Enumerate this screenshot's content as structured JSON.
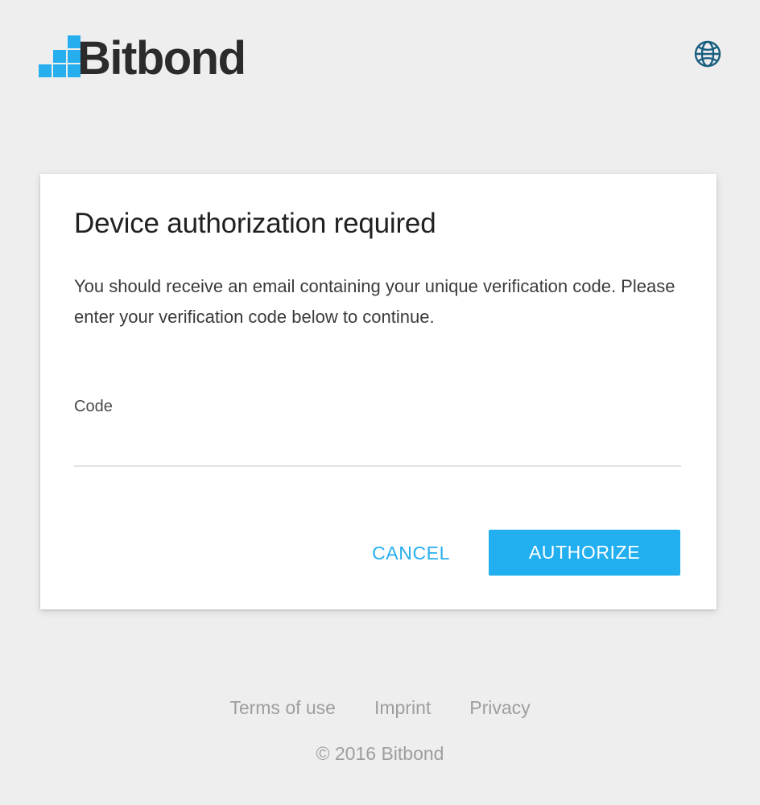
{
  "page": {
    "background_color": "#eeeeee",
    "accent_color": "#21aff0",
    "globe_color": "#1a5f80"
  },
  "header": {
    "logo_text": "Bitbond",
    "logo_icon": "bitbond-staircase-squares-icon",
    "language_icon": "globe-icon"
  },
  "card": {
    "title": "Device authorization required",
    "body": "You should receive an email containing your unique verification code. Please enter your verification code below to continue.",
    "form": {
      "code_label": "Code",
      "code_value": "",
      "code_placeholder": ""
    },
    "actions": {
      "cancel_label": "CANCEL",
      "authorize_label": "AUTHORIZE"
    }
  },
  "footer": {
    "links": [
      {
        "label": "Terms of use"
      },
      {
        "label": "Imprint"
      },
      {
        "label": "Privacy"
      }
    ],
    "copyright": "© 2016 Bitbond"
  }
}
